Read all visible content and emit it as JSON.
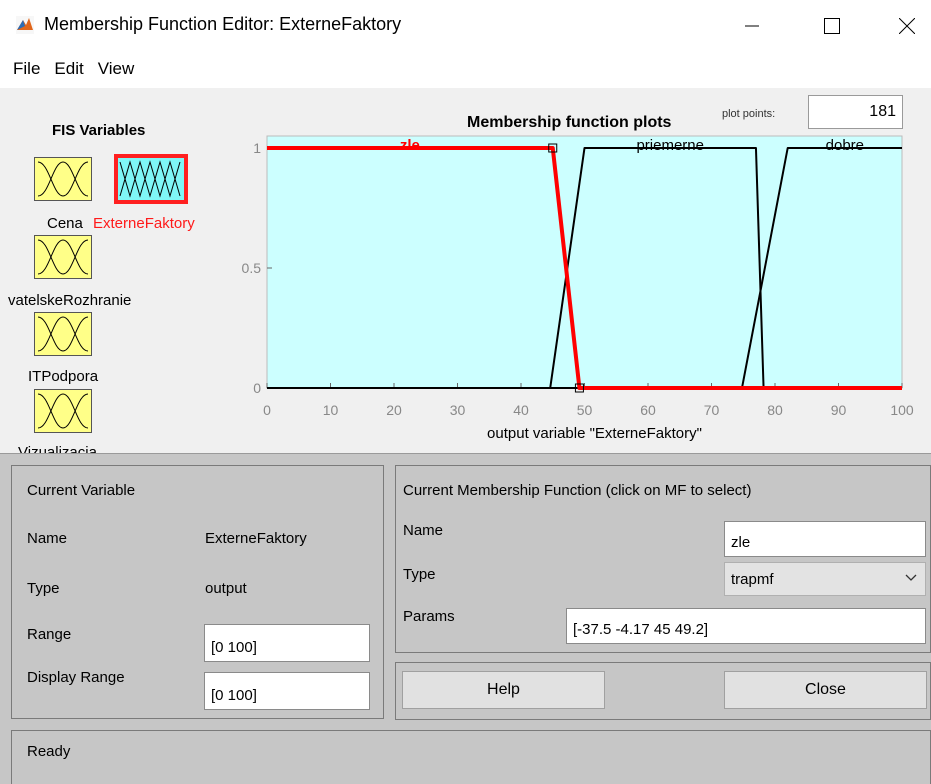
{
  "window": {
    "title": "Membership Function Editor: ExterneFaktory",
    "controls": [
      "minimize-icon",
      "maximize-icon",
      "close-icon"
    ]
  },
  "menu": [
    "File",
    "Edit",
    "View"
  ],
  "fis_variables": {
    "heading": "FIS Variables",
    "inputs": [
      {
        "label": "Cena"
      },
      {
        "label": "vatelskeRozhranie"
      },
      {
        "label": "ITPodpora"
      },
      {
        "label": "Vizualizacia"
      }
    ],
    "output": {
      "label": "ExterneFaktory",
      "selected": true
    }
  },
  "plot": {
    "title": "Membership function plots",
    "plot_points_label": "plot points:",
    "plot_points_value": "181"
  },
  "chart_data": {
    "type": "line",
    "xlabel": "output variable \"ExterneFaktory\"",
    "xlim": [
      0,
      100
    ],
    "ylim": [
      0,
      1.05
    ],
    "x_ticks": [
      "0",
      "10",
      "20",
      "30",
      "40",
      "50",
      "60",
      "70",
      "80",
      "90",
      "100"
    ],
    "y_ticks": [
      "0",
      "0.5",
      "1"
    ],
    "background": "#ccffff",
    "series": [
      {
        "name": "zle",
        "color": "#ff0000",
        "selected": true,
        "x": [
          0,
          45,
          49.2,
          100
        ],
        "y": [
          1,
          1,
          0,
          0
        ]
      },
      {
        "name": "priemerne",
        "color": "#000000",
        "x": [
          0,
          44.6,
          50,
          77,
          78.2,
          100
        ],
        "y": [
          0,
          0,
          1,
          1,
          0,
          0
        ]
      },
      {
        "name": "dobre",
        "color": "#000000",
        "x": [
          0,
          74.8,
          82,
          100
        ],
        "y": [
          0,
          0,
          1,
          1
        ]
      }
    ],
    "selected_handles": [
      [
        45,
        1
      ],
      [
        49.2,
        0
      ]
    ]
  },
  "current_variable": {
    "heading": "Current Variable",
    "name_label": "Name",
    "name_value": "ExterneFaktory",
    "type_label": "Type",
    "type_value": "output",
    "range_label": "Range",
    "range_value": "[0 100]",
    "display_range_label": "Display Range",
    "display_range_value": "[0 100]"
  },
  "current_mf": {
    "heading": "Current Membership Function (click on MF to select)",
    "name_label": "Name",
    "name_value": "zle",
    "type_label": "Type",
    "type_value": "trapmf",
    "params_label": "Params",
    "params_value": "[-37.5 -4.17 45 49.2]"
  },
  "buttons": {
    "help": "Help",
    "close": "Close"
  },
  "status": "Ready"
}
